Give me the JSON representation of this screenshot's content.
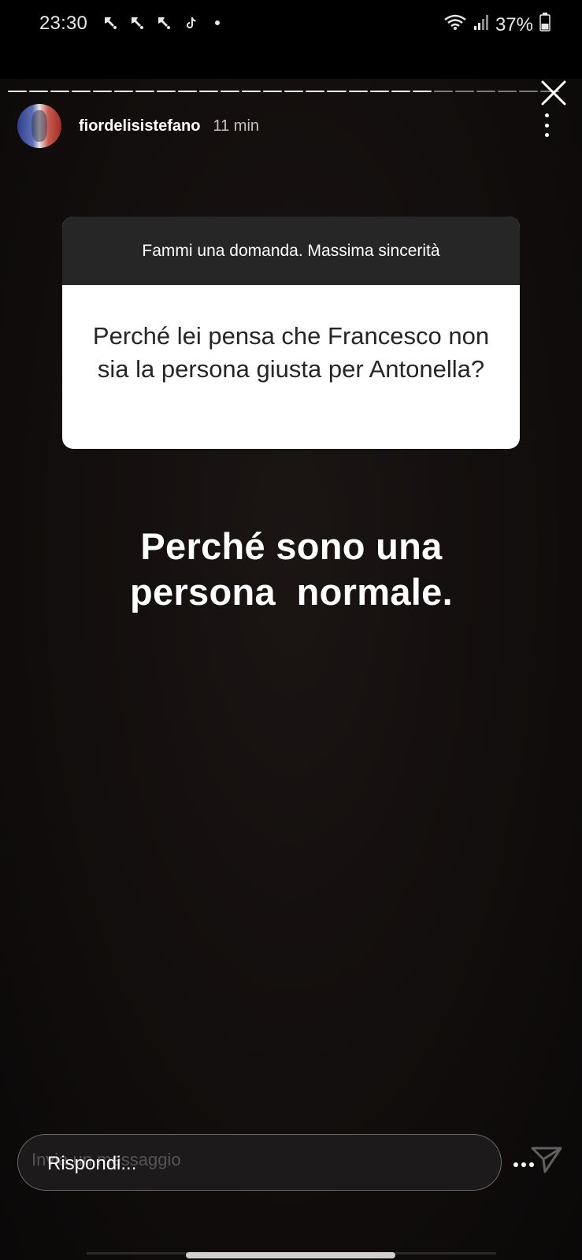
{
  "status_bar": {
    "time": "23:30",
    "notification_icons": [
      "notification-icon",
      "notification-icon",
      "notification-icon",
      "tiktok-icon",
      "dot-icon"
    ],
    "battery": "37%"
  },
  "story": {
    "progress_segments_total": 26,
    "progress_segments_viewed": 20,
    "username": "fiordelisistefano",
    "time_ago": "11 min",
    "question_sticker": {
      "prompt": "Fammi una domanda. Massima sincerità",
      "question": "Perché lei pensa che Francesco non sia la persona giusta per Antonella?"
    },
    "answer_line1": "Perché sono una",
    "answer_line2": "persona  normale."
  },
  "reply": {
    "placeholder": "Rispondi...",
    "ghost_text": "Invia un messaggio"
  }
}
